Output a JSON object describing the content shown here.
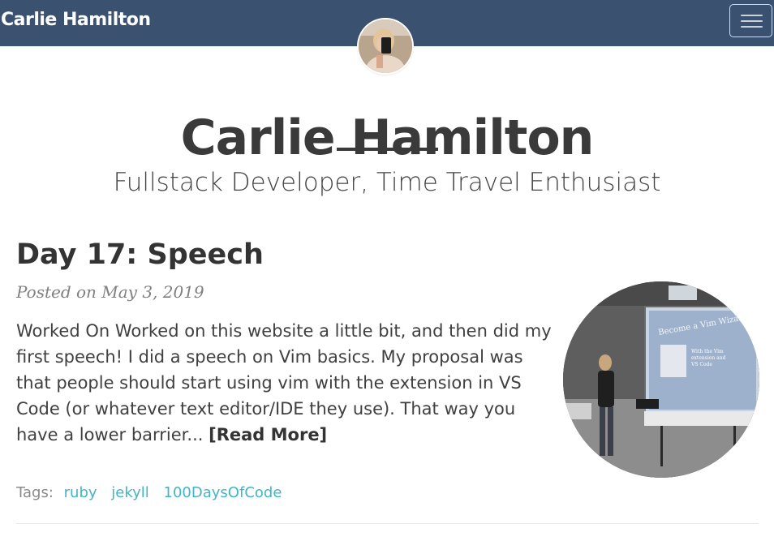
{
  "navbar": {
    "brand": "Carlie Hamilton",
    "menu_icon": "hamburger-menu-icon"
  },
  "header": {
    "avatar": "profile-photo",
    "title": "Carlie Hamilton",
    "tagline": "Fullstack Developer, Time Travel Enthusiast"
  },
  "post": {
    "title": "Day 17: Speech",
    "meta": "Posted on May 3, 2019",
    "excerpt": "Worked On Worked on this website a little bit, and then did my first speech! I did a speech on Vim basics. My proposal was that people should start using vim with the extension in VS Code (or whatever text editor/IDE they use). That way you have a lower barrier...",
    "read_more": "[Read More]",
    "image": {
      "slide_title": "Become a Vim Wizard",
      "slide_text": "With the Vim extension and VS Code"
    },
    "tags_label": "Tags:",
    "tags": [
      "ruby",
      "jekyll",
      "100DaysOfCode"
    ]
  },
  "colors": {
    "navbar": "#3b5170",
    "title": "#3a3a3a",
    "link": "#42b5c8",
    "meta": "#808080"
  }
}
